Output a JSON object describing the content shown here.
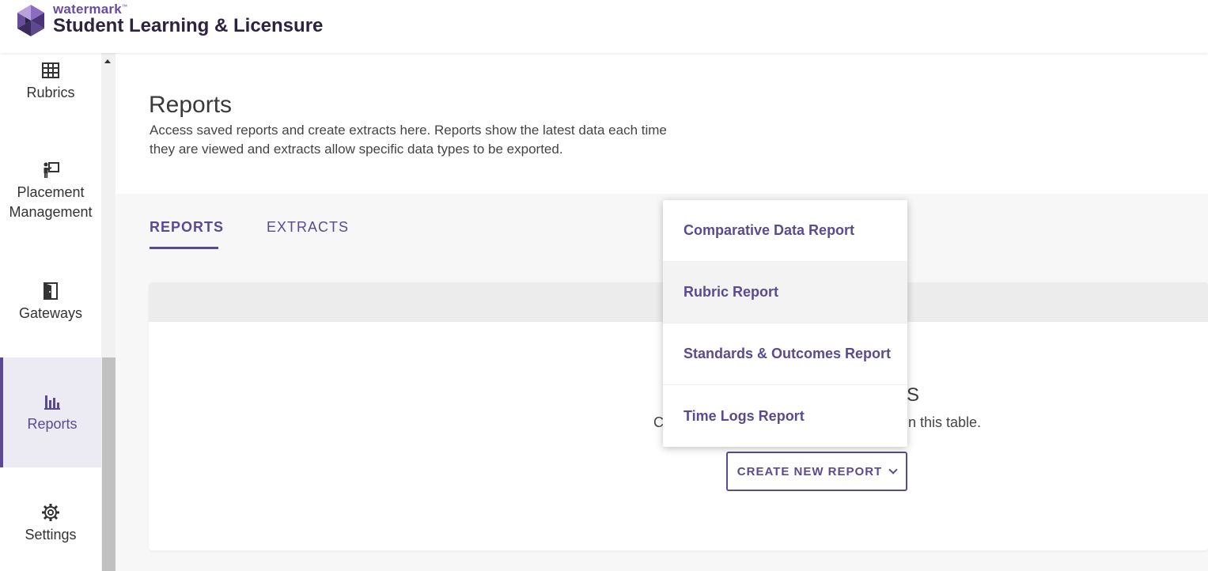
{
  "header": {
    "brand_small": "watermark",
    "brand_tm": "™",
    "app_name": "Student Learning & Licensure"
  },
  "sidebar": {
    "items": [
      {
        "label": "Rubrics",
        "icon": "table-grid-icon",
        "active": false
      },
      {
        "label": "Placement Management",
        "label_line1": "Placement",
        "label_line2": "Management",
        "icon": "presenter-icon",
        "active": false
      },
      {
        "label": "Gateways",
        "icon": "door-icon",
        "active": false
      },
      {
        "label": "Reports",
        "icon": "bar-chart-icon",
        "active": true
      },
      {
        "label": "Settings",
        "icon": "gear-icon",
        "active": false
      }
    ]
  },
  "page": {
    "title": "Reports",
    "description": "Access saved reports and create extracts here. Reports show the latest data each time they are viewed and extracts allow specific data types to be exported."
  },
  "tabs": [
    {
      "label": "REPORTS",
      "active": true
    },
    {
      "label": "EXTRACTS",
      "active": false
    }
  ],
  "empty_state": {
    "title_fragment": "S",
    "text_left_fragment": "C",
    "text_right_fragment": "n this table."
  },
  "create_button": {
    "label": "CREATE NEW REPORT",
    "icon": "chevron-down-icon"
  },
  "dropdown": {
    "items": [
      {
        "label": "Comparative Data Report",
        "hovered": false
      },
      {
        "label": "Rubric Report",
        "hovered": true
      },
      {
        "label": "Standards & Outcomes Report",
        "hovered": false
      },
      {
        "label": "Time Logs Report",
        "hovered": false
      }
    ]
  },
  "colors": {
    "accent": "#5b4a8f",
    "brand_purple": "#6a4c9c",
    "active_nav_bg": "#ecebf4"
  }
}
